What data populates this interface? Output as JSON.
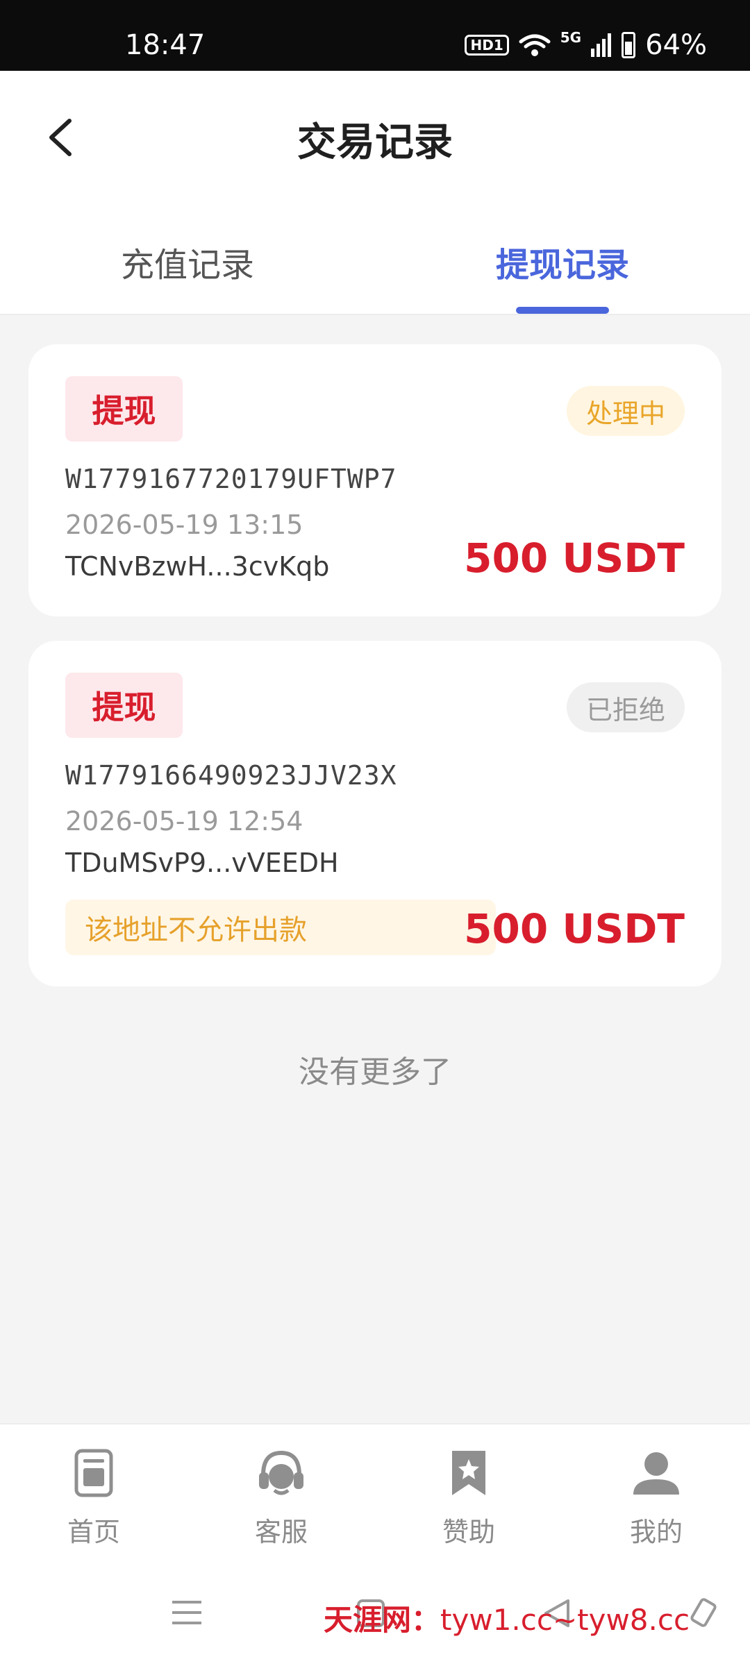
{
  "status_bar": {
    "time": "18:47",
    "hd_badge": "HD1",
    "network": "5G",
    "battery": "64%"
  },
  "header": {
    "title": "交易记录",
    "back_icon": "chevron-left-icon"
  },
  "tabs": [
    {
      "label": "充值记录",
      "active": false
    },
    {
      "label": "提现记录",
      "active": true
    }
  ],
  "colors": {
    "accent": "#4a66dc",
    "amount_red": "#d81e2d",
    "processing": "#e9a529",
    "rejected": "#9a9a9a"
  },
  "records": [
    {
      "type": "提现",
      "status": "处理中",
      "order_no": "W1779167720179UFTWP7",
      "time": "2026-05-19 13:15",
      "address": "TCNvBzwH...3cvKqb",
      "amount": "500 USDT"
    },
    {
      "type": "提现",
      "status": "已拒绝",
      "order_no": "W1779166490923JJV23X",
      "time": "2026-05-19 12:54",
      "address": "TDuMSvP9...vVEEDH",
      "note": "该地址不允许出款",
      "amount": "500 USDT"
    }
  ],
  "no_more": "没有更多了",
  "bottom_nav": [
    {
      "label": "首页",
      "icon": "home-icon"
    },
    {
      "label": "客服",
      "icon": "headset-icon"
    },
    {
      "label": "赞助",
      "icon": "bookmark-star-icon"
    },
    {
      "label": "我的",
      "icon": "user-icon"
    }
  ],
  "watermark": {
    "cn": "天涯网：",
    "url": "tyw1.cc~tyw8.cc"
  }
}
